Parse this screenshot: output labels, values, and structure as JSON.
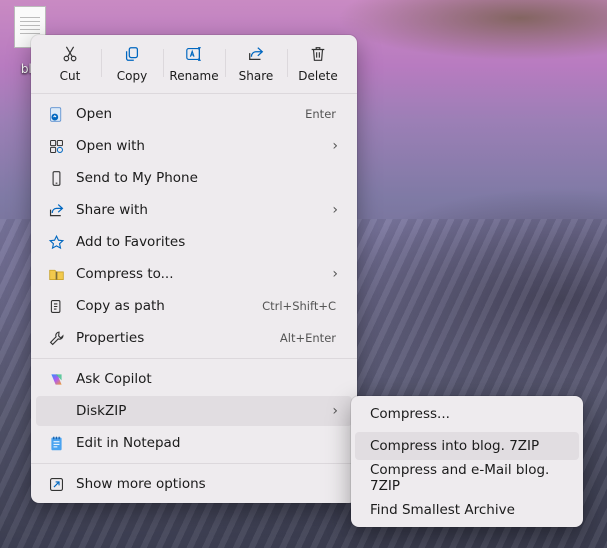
{
  "desktop": {
    "file_label": "blo"
  },
  "toolbar": [
    {
      "label": "Cut",
      "icon": "scissors-icon"
    },
    {
      "label": "Copy",
      "icon": "copy-icon"
    },
    {
      "label": "Rename",
      "icon": "rename-icon"
    },
    {
      "label": "Share",
      "icon": "share-icon"
    },
    {
      "label": "Delete",
      "icon": "trash-icon"
    }
  ],
  "menu": {
    "open": {
      "label": "Open",
      "shortcut": "Enter"
    },
    "open_with": {
      "label": "Open with"
    },
    "send_phone": {
      "label": "Send to My Phone"
    },
    "share_with": {
      "label": "Share with"
    },
    "favorites": {
      "label": "Add to Favorites"
    },
    "compress_to": {
      "label": "Compress to..."
    },
    "copy_path": {
      "label": "Copy as path",
      "shortcut": "Ctrl+Shift+C"
    },
    "properties": {
      "label": "Properties",
      "shortcut": "Alt+Enter"
    },
    "copilot": {
      "label": "Ask Copilot"
    },
    "diskzip": {
      "label": "DiskZIP"
    },
    "notepad": {
      "label": "Edit in Notepad"
    },
    "more": {
      "label": "Show more options"
    }
  },
  "submenu": [
    {
      "label": "Compress..."
    },
    {
      "label": "Compress into blog. 7ZIP"
    },
    {
      "label": "Compress and e-Mail blog. 7ZIP"
    },
    {
      "label": "Find Smallest Archive"
    }
  ],
  "colors": {
    "accent": "#0067c0",
    "copilot": "#7b5cf0",
    "star": "#0067c0"
  }
}
